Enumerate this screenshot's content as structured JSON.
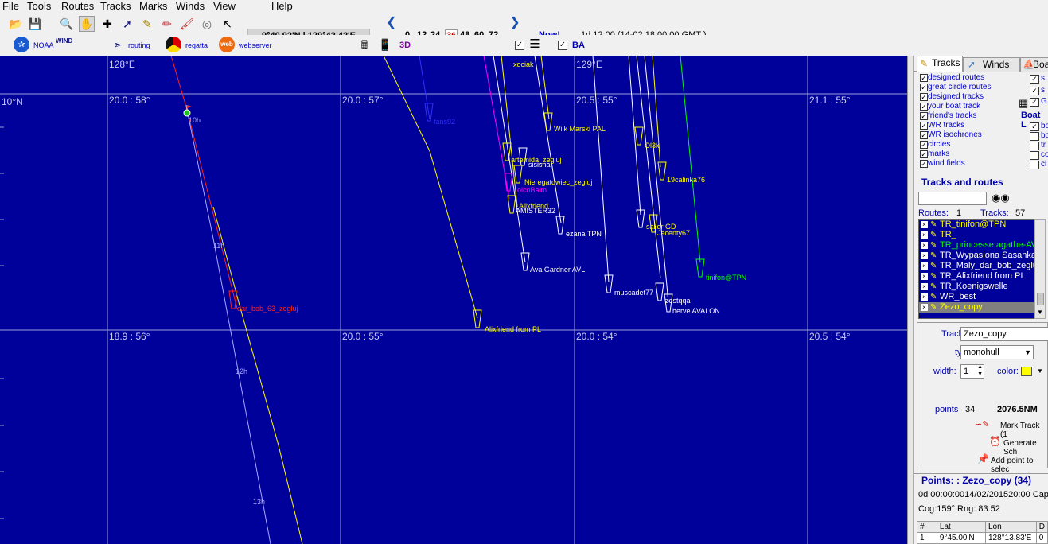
{
  "menu": [
    "File",
    "Tools",
    "Routes",
    "Tracks",
    "Marks",
    "Winds",
    "View",
    "Help"
  ],
  "toolbar": {
    "coordinates": "9°40.92'N | 129°42.42'E",
    "hours": [
      "0",
      "12",
      "24",
      "36",
      "48",
      "60",
      "72"
    ],
    "active_hour": "36",
    "now_label": "Now!",
    "time_label": "1d 12:00 (14-02 18:00:00 GMT )",
    "noaa_label": "NOAA",
    "wind_label": "WIND",
    "routing_label": "routing",
    "regatta_label": "regatta",
    "webserver_label": "webserver",
    "three_d_label": "3D",
    "ba_label": "BA",
    "web_label": "web"
  },
  "map": {
    "longitude_labels": [
      "128°E",
      "129°E"
    ],
    "latitude_label": "10°N",
    "grid_labels": [
      "20.0 : 58°",
      "20.0 : 57°",
      "20.5 : 55°",
      "21.1 : 55°",
      "18.9 : 56°",
      "20.0 : 55°",
      "20.0 : 54°",
      "20.5 : 54°"
    ],
    "boats": [
      {
        "name": "xociak",
        "color": "#ffff00"
      },
      {
        "name": "Wilk Marski PAL",
        "color": "#ffff00"
      },
      {
        "name": "artemida_zegluj",
        "color": "#ffff00"
      },
      {
        "name": "sisisha",
        "color": "#ffffff"
      },
      {
        "name": "Nieregatowiec_zegluj",
        "color": "#ffff00"
      },
      {
        "name": "olcoBalm",
        "color": "#ff00ff"
      },
      {
        "name": "Alixfriend",
        "color": "#ffff00"
      },
      {
        "name": "AMISTER32",
        "color": "#ffffff"
      },
      {
        "name": "ezana TPN",
        "color": "#ffffff"
      },
      {
        "name": "Ava Gardner AVL",
        "color": "#ffffff"
      },
      {
        "name": "muscadet77",
        "color": "#ffffff"
      },
      {
        "name": "Ol3k",
        "color": "#ffff00"
      },
      {
        "name": "19calinka76",
        "color": "#ffff00"
      },
      {
        "name": "Jacenty67",
        "color": "#ffff00"
      },
      {
        "name": "sailor GD",
        "color": "#ffff00"
      },
      {
        "name": "tinifon@TPN",
        "color": "#00ff00"
      },
      {
        "name": "herve AVALON",
        "color": "#ffffff"
      },
      {
        "name": "zestqqa",
        "color": "#ffffff"
      },
      {
        "name": "Alixfriend from PL",
        "color": "#ffff00"
      },
      {
        "name": "dar_bob_63_zegluj",
        "color": "#ff2020"
      },
      {
        "name": "fans92",
        "color": "#3030ff"
      }
    ],
    "hour_marks": [
      "10h",
      "11h",
      "12h",
      "13h"
    ]
  },
  "panel": {
    "tabs": [
      "Tracks",
      "Winds",
      "Boa"
    ],
    "layers": [
      {
        "label": "designed  routes",
        "checked": true
      },
      {
        "label": "great circle routes",
        "checked": true
      },
      {
        "label": "designed  tracks",
        "checked": true
      },
      {
        "label": "your boat track",
        "checked": true
      },
      {
        "label": "friend's tracks",
        "checked": true
      },
      {
        "label": "WR tracks",
        "checked": true
      },
      {
        "label": "WR isochrones",
        "checked": true
      },
      {
        "label": "circles",
        "checked": true
      },
      {
        "label": "marks",
        "checked": true
      },
      {
        "label": "wind fields",
        "checked": true
      }
    ],
    "right_col": [
      {
        "label": "s",
        "checked": true
      },
      {
        "label": "s",
        "checked": true
      },
      {
        "label": "G",
        "checked": true
      }
    ],
    "boat_layers_heading": "Boat L",
    "boat_layers": [
      {
        "label": "bo",
        "checked": true
      },
      {
        "label": "bo",
        "checked": false
      },
      {
        "label": "tr",
        "checked": false
      },
      {
        "label": "co",
        "checked": false
      },
      {
        "label": "cl",
        "checked": false
      }
    ],
    "tracks_heading": "Tracks and routes",
    "routes_label": "Routes:",
    "routes_count": "1",
    "tracks_label": "Tracks:",
    "tracks_count": "57",
    "track_list": [
      {
        "name": "TR_tinifon@TPN",
        "color": "#ffff00",
        "selected": false
      },
      {
        "name": "TR_",
        "color": "#ffff00",
        "selected": false
      },
      {
        "name": "TR_princesse agathe-AVL",
        "color": "#00ff00",
        "selected": false
      },
      {
        "name": "TR_Wypasiona Sasanka",
        "color": "#ffffff",
        "selected": false
      },
      {
        "name": "TR_Maly_dar_bob_zegluj",
        "color": "#ffffff",
        "selected": false
      },
      {
        "name": "TR_Alixfriend from PL",
        "color": "#ffffff",
        "selected": false
      },
      {
        "name": "TR_Koenigswelle",
        "color": "#ffffff",
        "selected": false
      },
      {
        "name": "WR_best",
        "color": "#ffffff",
        "selected": false
      },
      {
        "name": "Zezo_copy",
        "color": "#ffff00",
        "selected": true
      }
    ],
    "track_label": "Track:",
    "track_name": "Zezo_copy",
    "type_label": "type:",
    "type_value": "monohull",
    "width_label": "width:",
    "width_value": "1",
    "color_label": "color:",
    "color_value": "#ffff00",
    "points_label": "points",
    "points_count": "34",
    "distance": "2076.5NM",
    "mark_track_label": "Mark Track (1",
    "generate_label": "Generate Sch",
    "add_point_label": "Add point to selec",
    "points_heading": "Points: : Zezo_copy (34)",
    "points_info1": "0d 00:00:0014/02/201520:00 Cap",
    "points_info2": "Cog:159° Rng: 83.52",
    "table_headers": [
      "#",
      "Lat",
      "Lon",
      "D"
    ],
    "table_rows": [
      [
        "1",
        "9°45.00'N",
        "128°13.83'E",
        "0"
      ]
    ]
  }
}
